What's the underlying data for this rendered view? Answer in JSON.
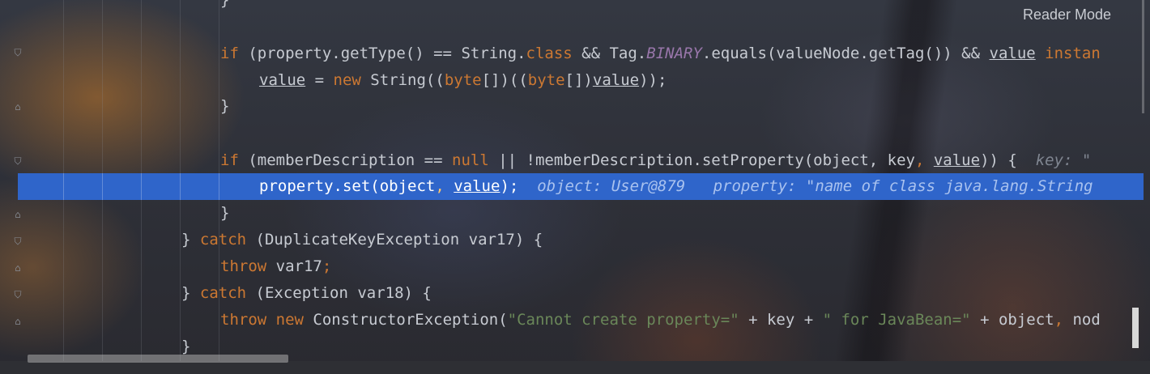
{
  "editor": {
    "reader_mode_label": "Reader Mode",
    "lines": [
      {
        "id": "l0",
        "t": "}"
      },
      {
        "id": "l1",
        "parts": [
          "if",
          "(property.getType() == String.",
          "class",
          "&& Tag.",
          "BINARY",
          ".equals(valueNode.getTag()) &&",
          "value",
          "instan"
        ]
      },
      {
        "id": "l2",
        "parts": [
          "value",
          " = ",
          "new",
          " String((",
          "byte",
          "[])((",
          "byte",
          "[])",
          "value",
          "));"
        ]
      },
      {
        "id": "l3",
        "t": "}"
      },
      {
        "id": "l4",
        "parts": [
          "if",
          " (memberDescription == ",
          "null",
          " || !memberDescription.setProperty(object, key",
          ", ",
          "value",
          ")) {",
          "key: \""
        ]
      },
      {
        "id": "l5",
        "parts": [
          "property.set(object",
          ", ",
          "value",
          ");",
          "object: User@879",
          "property: \"name of class java.lang.String"
        ]
      },
      {
        "id": "l6",
        "t": "}"
      },
      {
        "id": "l7",
        "parts": [
          "} ",
          "catch",
          " (DuplicateKeyException var17) {"
        ]
      },
      {
        "id": "l8",
        "parts": [
          "throw",
          " var17",
          ";"
        ]
      },
      {
        "id": "l9",
        "parts": [
          "} ",
          "catch",
          " (Exception var18) {"
        ]
      },
      {
        "id": "l10",
        "parts": [
          "throw",
          " ",
          "new",
          " ConstructorException(",
          "\"Cannot create property=\"",
          " + key + ",
          "\" for JavaBean=\"",
          " + object",
          ", ",
          "nod"
        ]
      },
      {
        "id": "l11",
        "t": "}"
      }
    ]
  }
}
